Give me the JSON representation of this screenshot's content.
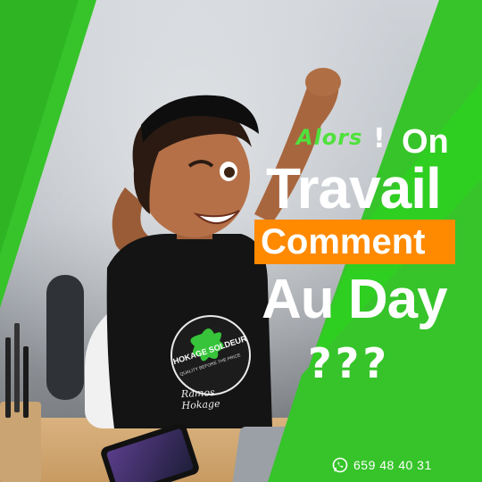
{
  "headline": {
    "alors": "Alors",
    "exclamation": "!",
    "on": "On",
    "travail": "Travail",
    "comment": "Comment",
    "au_day": "Au Day",
    "question_marks": "???"
  },
  "contact": {
    "icon": "whatsapp-icon",
    "phone": "659 48 40 31"
  },
  "shirt": {
    "brand": "HOKAGE SOLDEUR",
    "tagline": "QUALITY BEFORE THE PRICE",
    "signature": "Ramos Hokage"
  },
  "colors": {
    "green": "#36c42a",
    "green_light": "#4fe13c",
    "orange": "#ff8a00",
    "white": "#ffffff"
  }
}
